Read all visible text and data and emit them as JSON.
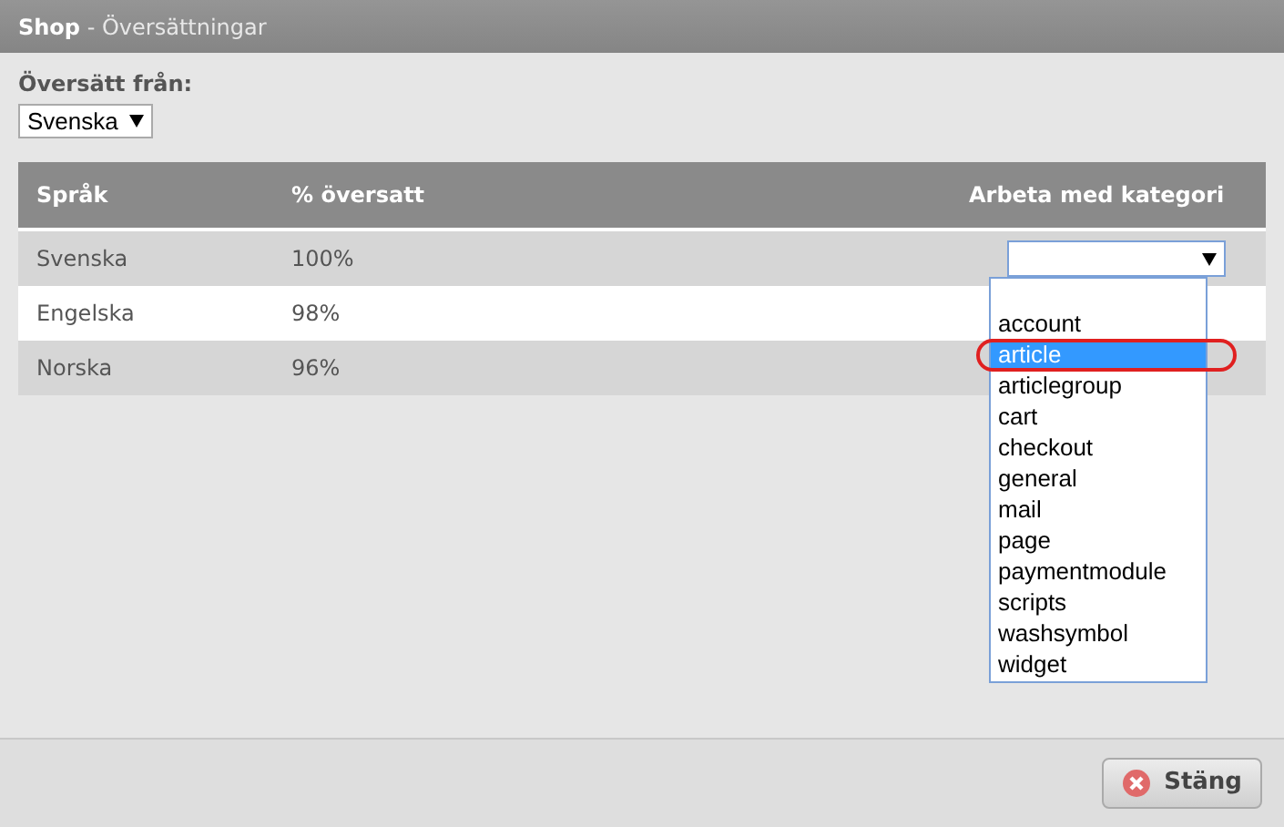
{
  "window": {
    "app": "Shop",
    "title": " - Översättningar"
  },
  "source": {
    "label": "Översätt från:",
    "value": "Svenska"
  },
  "table": {
    "columns": [
      "Språk",
      "% översatt",
      "Arbeta med kategori"
    ],
    "rows": [
      {
        "language": "Svenska",
        "percent": "100%"
      },
      {
        "language": "Engelska",
        "percent": "98%"
      },
      {
        "language": "Norska",
        "percent": "96%"
      }
    ]
  },
  "category_dropdown": {
    "expanded": true,
    "options": [
      {
        "label": "account",
        "selected": false
      },
      {
        "label": "article",
        "selected": true
      },
      {
        "label": "articlegroup",
        "selected": false
      },
      {
        "label": "cart",
        "selected": false
      },
      {
        "label": "checkout",
        "selected": false
      },
      {
        "label": "general",
        "selected": false
      },
      {
        "label": "mail",
        "selected": false
      },
      {
        "label": "page",
        "selected": false
      },
      {
        "label": "paymentmodule",
        "selected": false
      },
      {
        "label": "scripts",
        "selected": false
      },
      {
        "label": "washsymbol",
        "selected": false
      },
      {
        "label": "widget",
        "selected": false
      }
    ]
  },
  "close_button": "Stäng"
}
